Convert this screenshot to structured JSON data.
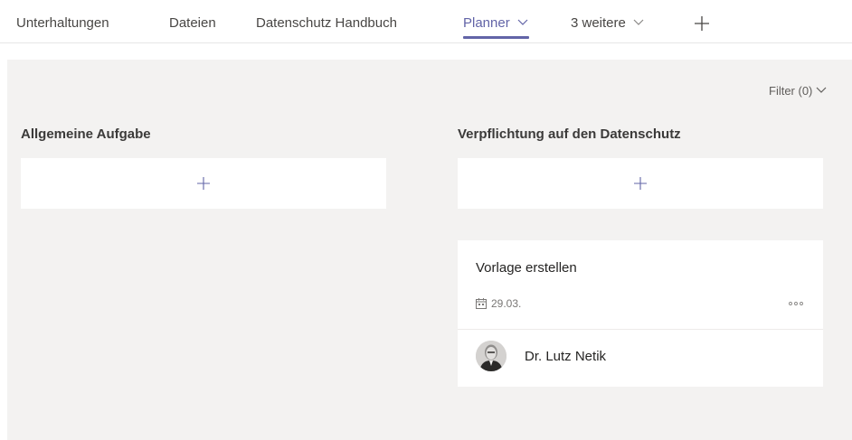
{
  "tabs": [
    {
      "label": "Unterhaltungen"
    },
    {
      "label": "Dateien"
    },
    {
      "label": "Datenschutz Handbuch"
    },
    {
      "label": "Planner",
      "active": true
    },
    {
      "label": "3 weitere"
    }
  ],
  "tab_add_icon": "plus-icon",
  "filter": {
    "label": "Filter (0)"
  },
  "buckets": [
    {
      "title": "Allgemeine Aufgabe"
    },
    {
      "title": "Verpflichtung auf den Datenschutz"
    }
  ],
  "task": {
    "title": "Vorlage erstellen",
    "due_date": "29.03.",
    "assignee": "Dr. Lutz Netik"
  },
  "colors": {
    "accent": "#6264a7",
    "board_background": "#f3f2f1",
    "card_background": "#ffffff"
  }
}
